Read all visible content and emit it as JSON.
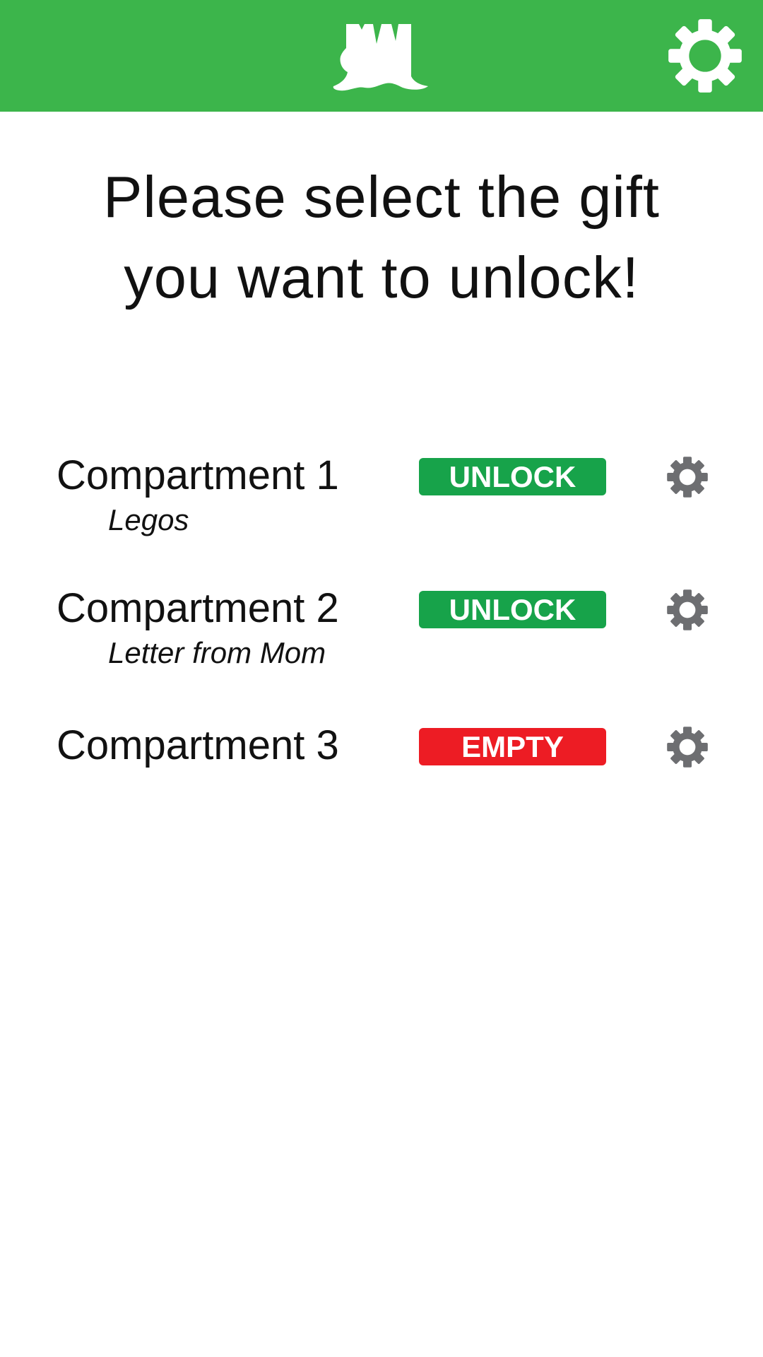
{
  "header": {
    "logo_icon": "tree-stump-icon",
    "settings_icon": "gear-icon",
    "background_color": "#3cb54b"
  },
  "prompt": {
    "line1": "Please select the gift",
    "line2": "you want to unlock!"
  },
  "compartments": [
    {
      "title": "Compartment 1",
      "gift": "Legos",
      "action": "UNLOCK",
      "action_color": "#17a34a",
      "settings_icon": "gear-icon"
    },
    {
      "title": "Compartment 2",
      "gift": "Letter from Mom",
      "action": "UNLOCK",
      "action_color": "#17a34a",
      "settings_icon": "gear-icon"
    },
    {
      "title": "Compartment 3",
      "gift": "",
      "action": "EMPTY",
      "action_color": "#ed1c24",
      "settings_icon": "gear-icon"
    }
  ]
}
